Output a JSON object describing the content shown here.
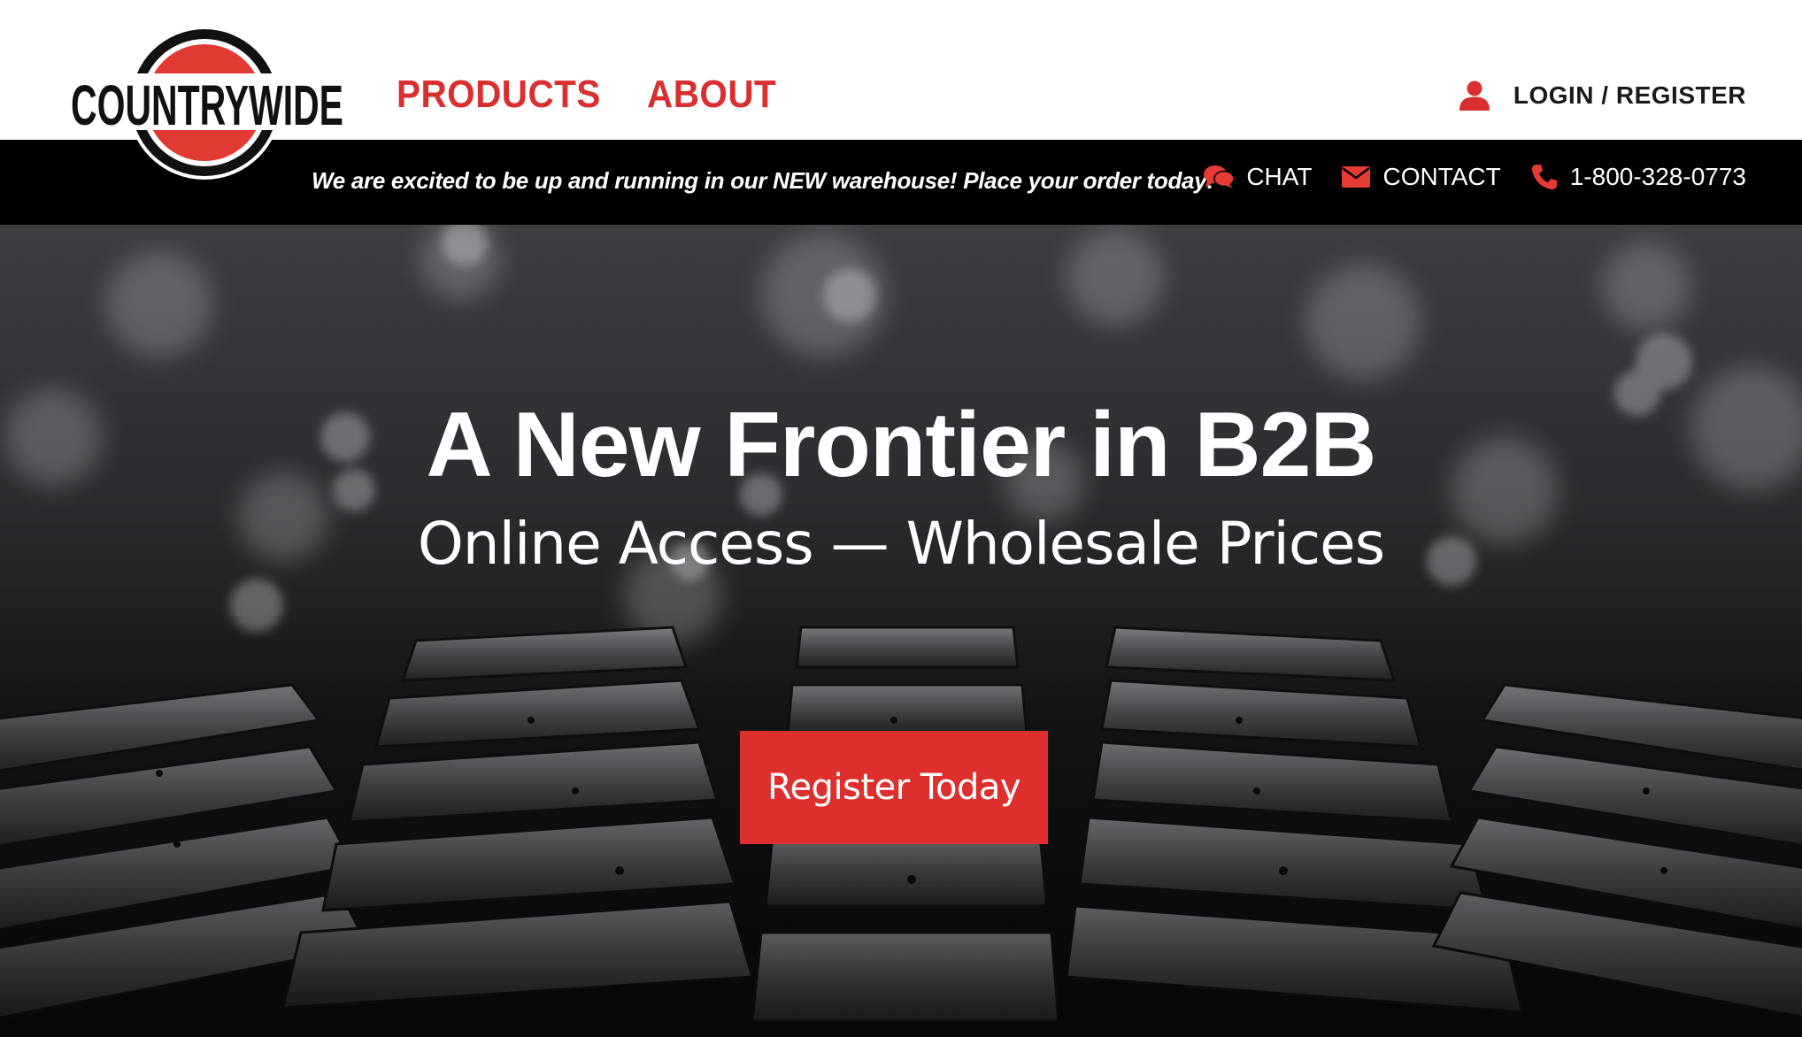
{
  "brand": {
    "logo_text": "COUNTRYWIDE",
    "primary_color": "#d92f2f"
  },
  "nav": {
    "items": [
      {
        "label": "PRODUCTS"
      },
      {
        "label": "ABOUT"
      }
    ]
  },
  "account": {
    "login_label": "LOGIN / REGISTER",
    "icon": "user-icon"
  },
  "topbar": {
    "announcement": "We are excited to be up and running in our NEW warehouse! Place your order today!",
    "chat_label": "CHAT",
    "contact_label": "CONTACT",
    "phone": "1-800-328-0773"
  },
  "hero": {
    "title": "A New Frontier in B2B",
    "subtitle": "Online Access — Wholesale Prices",
    "cta_label": "Register Today"
  }
}
